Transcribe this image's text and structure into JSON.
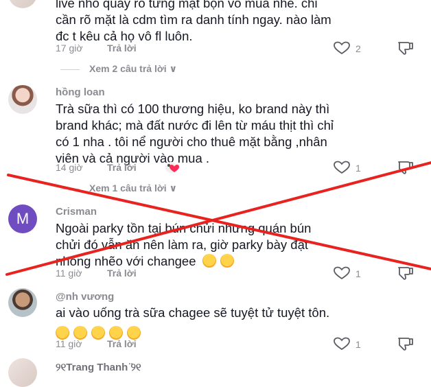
{
  "comments": [
    {
      "text_lines": [
        "live nhỏ quay rõ từng mặt bọn vô mua nhé. chỉ",
        "cần rõ mặt là cdm tìm ra danh tính ngay. nào làm",
        "đc t kêu cả họ vô fl luôn."
      ],
      "time": "17 giờ",
      "reply": "Trả lời",
      "likes": "2",
      "view_more": "Xem 2 câu trả lời"
    },
    {
      "author": "hồng loan",
      "text_lines": [
        "Trà sữa thì có 100 thương hiệu, ko brand này thì",
        "brand khác; mà đất nước đi lên từ máu thịt thì chỉ",
        "có 1 nha . tôi nể người cho thuê mặt bằng ,nhân",
        "viên và cả người vào mua ."
      ],
      "time": "14 giờ",
      "reply": "Trả lời",
      "likes": "1",
      "view_more": "Xem 1 câu trả lời"
    },
    {
      "author": "Crisman",
      "avatar_letter": "M",
      "text_lines": [
        "Ngoài parky tồn tại bún chửi nhưng quán bún",
        "chửi đó vẫn ăn nên làm ra, giờ parky bày đặt",
        "nhõng nhẽo với changee"
      ],
      "time": "11 giờ",
      "reply": "Trả lời",
      "likes": "1"
    },
    {
      "author": "@nh vương",
      "text_lines": [
        "ai vào uống trà sữa chagee sẽ tuyệt tử tuyệt tôn."
      ],
      "time": "11 giờ",
      "reply": "Trả lời",
      "likes": "1"
    },
    {
      "author": "୨୧Trang Thanh ̈୨୧"
    }
  ],
  "colors": {
    "cross": "#e8231f",
    "muted": "#8a8b91",
    "avatar_m": "#6f4cc0"
  },
  "icons": [
    "heart-outline-icon",
    "dislike-icon",
    "chevron-down-icon",
    "laughing-emoji-icon",
    "grinning-emoji-icon",
    "reaction-badge-icon"
  ]
}
